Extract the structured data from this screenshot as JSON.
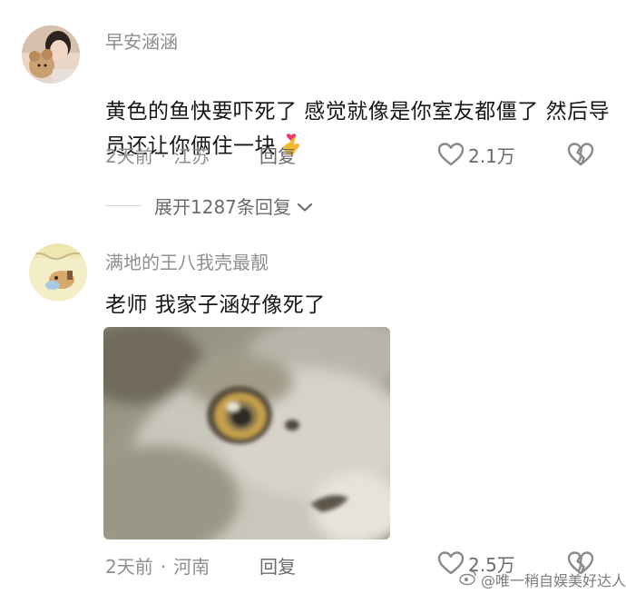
{
  "comments": [
    {
      "username": "早安涵涵",
      "text": "黄色的鱼快要吓死了 感觉就像是你室友都僵了 然后导员还让你俩住一块",
      "emoji": "🫰",
      "time": "2天前",
      "location": "江苏",
      "reply_label": "回复",
      "likes": "2.1万",
      "expand_label": "展开1287条回复"
    },
    {
      "username": "满地的王八我壳最靓",
      "text": "老师 我家子涵好像死了",
      "time": "2天前",
      "location": "河南",
      "reply_label": "回复",
      "likes": "2.5万"
    }
  ],
  "separator": "·",
  "watermark": "@唯一稍自娱美好达人",
  "icons": {
    "like": "heart-icon",
    "dislike": "broken-heart-icon",
    "expand": "chevron-down-icon",
    "watermark": "weibo-logo-icon"
  },
  "colors": {
    "username": "#8e8e93",
    "text": "#161616",
    "meta": "#8e8e93"
  }
}
